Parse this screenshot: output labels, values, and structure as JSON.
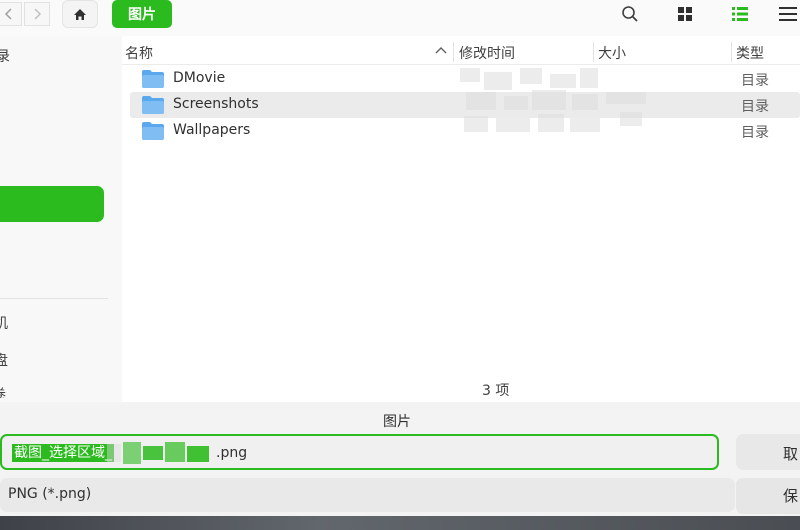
{
  "toolbar": {
    "back_icon": "chevron-left-icon",
    "forward_icon": "chevron-right-icon",
    "home_icon": "home-icon",
    "breadcrumb": "图片",
    "search_icon": "search-icon",
    "grid_view_icon": "grid-view-icon",
    "list_view_icon": "list-view-icon",
    "menu_icon": "menu-icon"
  },
  "sidebar": {
    "items": [
      "录",
      "机",
      "盘",
      "卷"
    ]
  },
  "columns": {
    "name": "名称",
    "modified": "修改时间",
    "size": "大小",
    "type": "类型"
  },
  "files": [
    {
      "name": "DMovie",
      "type": "目录"
    },
    {
      "name": "Screenshots",
      "type": "目录"
    },
    {
      "name": "Wallpapers",
      "type": "目录"
    }
  ],
  "status": {
    "count": "3 项"
  },
  "save": {
    "location_label": "图片",
    "filename_prefix": "截图_选择区域_",
    "filename_ext": ".png",
    "filter": "PNG (*.png)",
    "cancel_label": "取",
    "save_label": "保"
  },
  "colors": {
    "accent": "#2cbb1f",
    "folder": "#5aa9ee"
  }
}
